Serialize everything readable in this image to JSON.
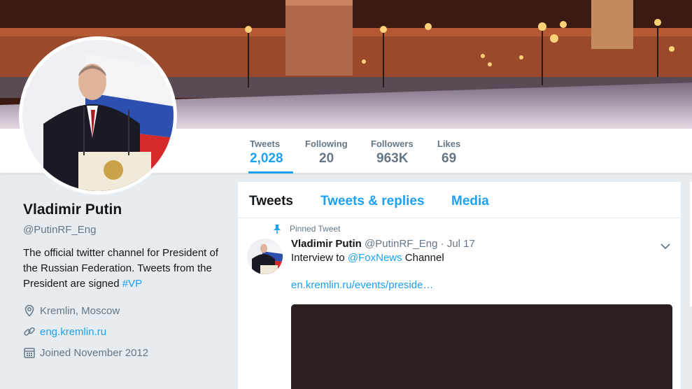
{
  "profile": {
    "name": "Vladimir Putin",
    "handle": "@PutinRF_Eng",
    "bio_text": "The official twitter channel for President of the Russian Federation. Tweets from the President are signed ",
    "bio_hashtag": "#VP",
    "location": "Kremlin, Moscow",
    "website": "eng.kremlin.ru",
    "joined": "Joined November 2012"
  },
  "stats": [
    {
      "label": "Tweets",
      "value": "2,028",
      "active": true
    },
    {
      "label": "Following",
      "value": "20"
    },
    {
      "label": "Followers",
      "value": "963K"
    },
    {
      "label": "Likes",
      "value": "69"
    }
  ],
  "tabs": {
    "tweets": "Tweets",
    "replies": "Tweets & replies",
    "media": "Media"
  },
  "pinned_tweet": {
    "pinned_label": "Pinned Tweet",
    "author": "Vladimir Putin",
    "handle": "@PutinRF_Eng",
    "separator": "·",
    "date": "Jul 17",
    "text_prefix": "Interview to ",
    "mention": "@FoxNews",
    "text_suffix": " Channel",
    "link": "en.kremlin.ru/events/preside…"
  },
  "colors": {
    "accent": "#1da1f2",
    "muted": "#657786",
    "text": "#14171a",
    "background": "#e6ecf0"
  },
  "icons": [
    "location-icon",
    "link-icon",
    "calendar-icon",
    "pin-icon",
    "chevron-down-icon"
  ]
}
